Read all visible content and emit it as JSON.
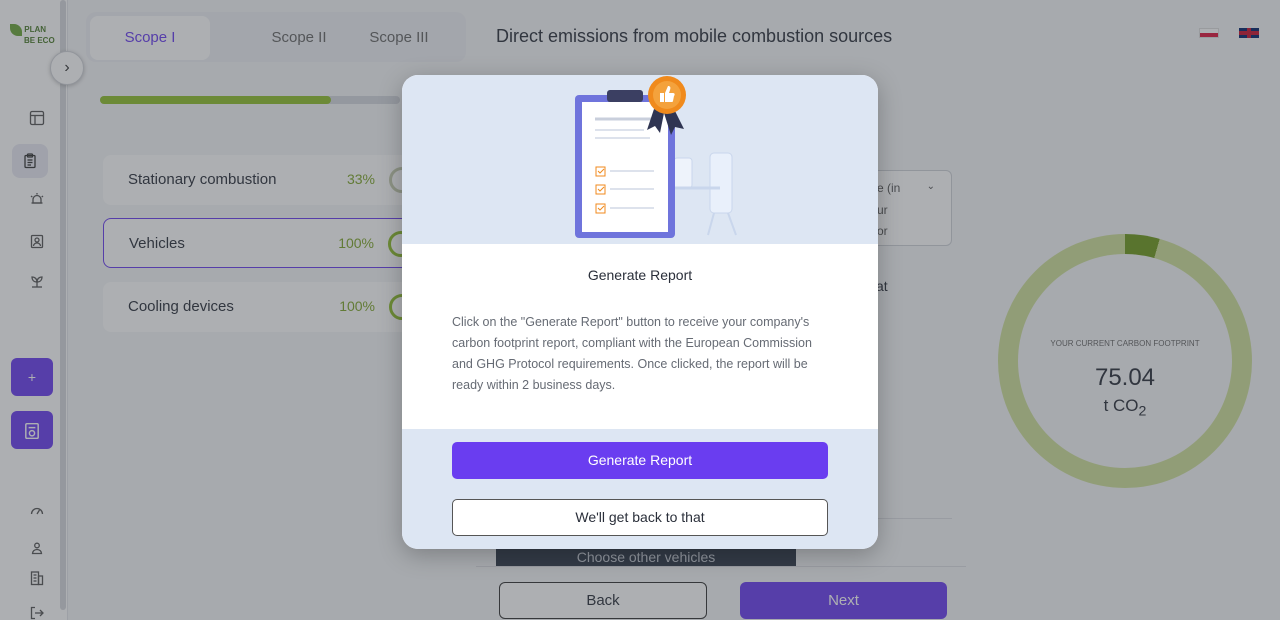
{
  "logo": {
    "line1": "PLAN",
    "line2": "BE ECO"
  },
  "tabs": [
    {
      "label": "Scope I",
      "active": true
    },
    {
      "label": "Scope II",
      "active": false
    },
    {
      "label": "Scope III",
      "active": false
    }
  ],
  "progress": {
    "fraction": 0.77
  },
  "categories": [
    {
      "label": "Stationary combustion",
      "percent": "33%"
    },
    {
      "label": "Vehicles",
      "percent": "100%"
    },
    {
      "label": "Cooling devices",
      "percent": "100%"
    }
  ],
  "page_title": "Direct emissions from mobile combustion sources",
  "dropdown_fragments": [
    "e (in",
    "ur",
    "or"
  ],
  "text_fragment": "at",
  "footprint": {
    "caption": "YOUR CURRENT CARBON FOOTPRINT",
    "value": "75.04",
    "unit": "t CO",
    "unit_sub": "2",
    "fraction": 0.044
  },
  "choose_vehicles": "Choose other vehicles",
  "nav": {
    "back": "Back",
    "next": "Next"
  },
  "sidebar": {
    "add_label": "+"
  },
  "modal": {
    "title": "Generate Report",
    "body": "Click on the \"Generate Report\" button to receive your company's carbon footprint report, compliant with the European Commission and GHG Protocol requirements. Once clicked, the report will be ready within 2 business days.",
    "primary_button": "Generate Report",
    "secondary_button": "We'll get back to that"
  },
  "colors": {
    "accent": "#6a3df0",
    "green": "#8fbf2c",
    "donut_dark": "#6e9a1c",
    "donut_light": "#cfe19a",
    "modal_bg": "#dde6f3",
    "badge": "#f08a1c"
  }
}
